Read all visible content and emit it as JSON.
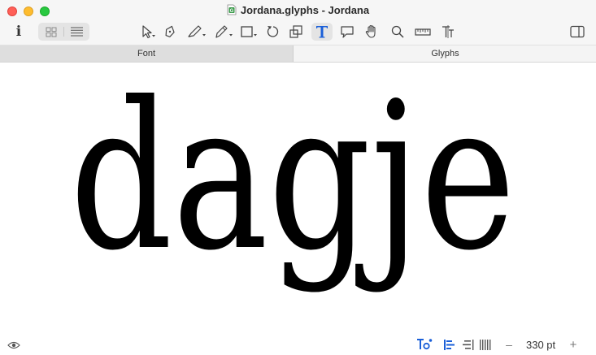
{
  "window": {
    "title": "Jordana.glyphs - Jordana"
  },
  "tabs": [
    {
      "label": "Font",
      "active": false
    },
    {
      "label": "Glyphs",
      "active": true
    }
  ],
  "toolbar": {
    "icons": [
      "info-icon",
      "grid-view-icon",
      "list-view-icon",
      "select-tool-icon",
      "pen-tool-icon",
      "draw-tool-icon",
      "pencil-tool-icon",
      "rectangle-tool-icon",
      "rotate-tool-icon",
      "scale-tool-icon",
      "text-tool-icon",
      "annotation-tool-icon",
      "hand-tool-icon",
      "zoom-tool-icon",
      "measure-tool-icon",
      "kerning-tool-icon",
      "sidebar-toggle-icon"
    ],
    "active_tool": "text-tool-icon"
  },
  "canvas": {
    "text": "dagje"
  },
  "statusbar": {
    "zoom_minus": "–",
    "zoom": "330 pt",
    "zoom_plus": "+"
  },
  "colors": {
    "accent": "#1a5fd8",
    "tab_inactive_bg": "#dedede",
    "tab_active_bg": "#f4f4f4"
  }
}
